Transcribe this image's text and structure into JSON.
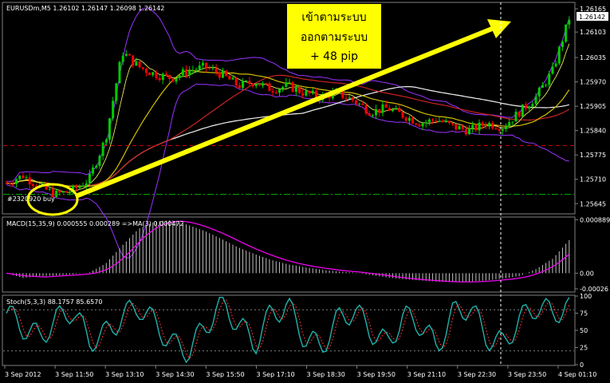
{
  "chart_data": [
    {
      "type": "candlestick",
      "symbol_header": "EURUSDm,M5  1.26102 1.26147 1.26098 1.26142",
      "ylim": [
        1.2562,
        1.2618
      ],
      "y_ticks": [
        "1.26165",
        "1.26103",
        "1.26035",
        "1.25970",
        "1.25905",
        "1.25840",
        "1.25775",
        "1.25710",
        "1.25645"
      ],
      "current_price": "1.26142",
      "x_ticks": [
        "3 Sep 2012",
        "3 Sep 11:50",
        "3 Sep 13:10",
        "3 Sep 14:30",
        "3 Sep 15:50",
        "3 Sep 17:10",
        "3 Sep 18:30",
        "3 Sep 19:50",
        "3 Sep 21:10",
        "3 Sep 22:30",
        "3 Sep 23:50",
        "4 Sep 01:10"
      ],
      "order_label": "#2320920 buy",
      "levels": {
        "red_dashed": 1.258,
        "green_dashed": 1.2567
      },
      "close_path": [
        1.257,
        1.2572,
        1.2569,
        1.2567,
        1.2568,
        1.2571,
        1.2582,
        1.2605,
        1.2601,
        1.2599,
        1.2598,
        1.26,
        1.2601,
        1.2599,
        1.2596,
        1.2597,
        1.2595,
        1.2596,
        1.2594,
        1.2593,
        1.2594,
        1.2592,
        1.2589,
        1.259,
        1.2588,
        1.2586,
        1.2587,
        1.2585,
        1.2584,
        1.2586,
        1.2585,
        1.2589,
        1.2593,
        1.26,
        1.2614
      ]
    },
    {
      "type": "macd",
      "label": "MACD(15,35,9) 0.000555 0.000289  =>MA(3) 0.000472",
      "y_ticks": [
        "0.000889",
        "0.00",
        "-0.00026"
      ],
      "histogram": [
        0.0,
        -8e-05,
        -5e-05,
        -4e-05,
        -2e-05,
        1e-05,
        0.00016,
        0.00046,
        0.00074,
        0.00086,
        0.00088,
        0.0008,
        0.0007,
        0.00057,
        0.00043,
        0.00032,
        0.00022,
        0.00015,
        0.0001,
        6e-05,
        3e-05,
        1e-05,
        -3e-05,
        -7e-05,
        -0.0001,
        -0.00012,
        -0.00014,
        -0.00015,
        -0.00014,
        -0.00012,
        -9e-05,
        -5e-05,
        7e-05,
        0.00024,
        0.00055
      ]
    },
    {
      "type": "stochastic",
      "label": "Stoch(5,3,3) 88.1757 85.6570",
      "y_ticks": [
        "100",
        "75",
        "50",
        "25",
        "0"
      ],
      "k": [
        75,
        55,
        40,
        65,
        80,
        35,
        45,
        70,
        85,
        60,
        30,
        20,
        55,
        90,
        60,
        30,
        75,
        85,
        40,
        25,
        65,
        80,
        50,
        30,
        70,
        60,
        25,
        75,
        85,
        40,
        30,
        65,
        85,
        75,
        85
      ]
    }
  ],
  "annotation": {
    "line1": "เข้าตามระบบ",
    "line2": "ออกตามระบบ",
    "line3": "+ 48 pip"
  },
  "colors": {
    "background": "#000000",
    "bull": "#00cc00",
    "bear": "#ff0000",
    "arrow": "#ffff00",
    "annotation_box": "#ffff00",
    "macd_signal": "#ff00ff",
    "stoch_main": "#20b2aa",
    "stoch_signal": "#ff3030",
    "bands": "#9933ff"
  }
}
